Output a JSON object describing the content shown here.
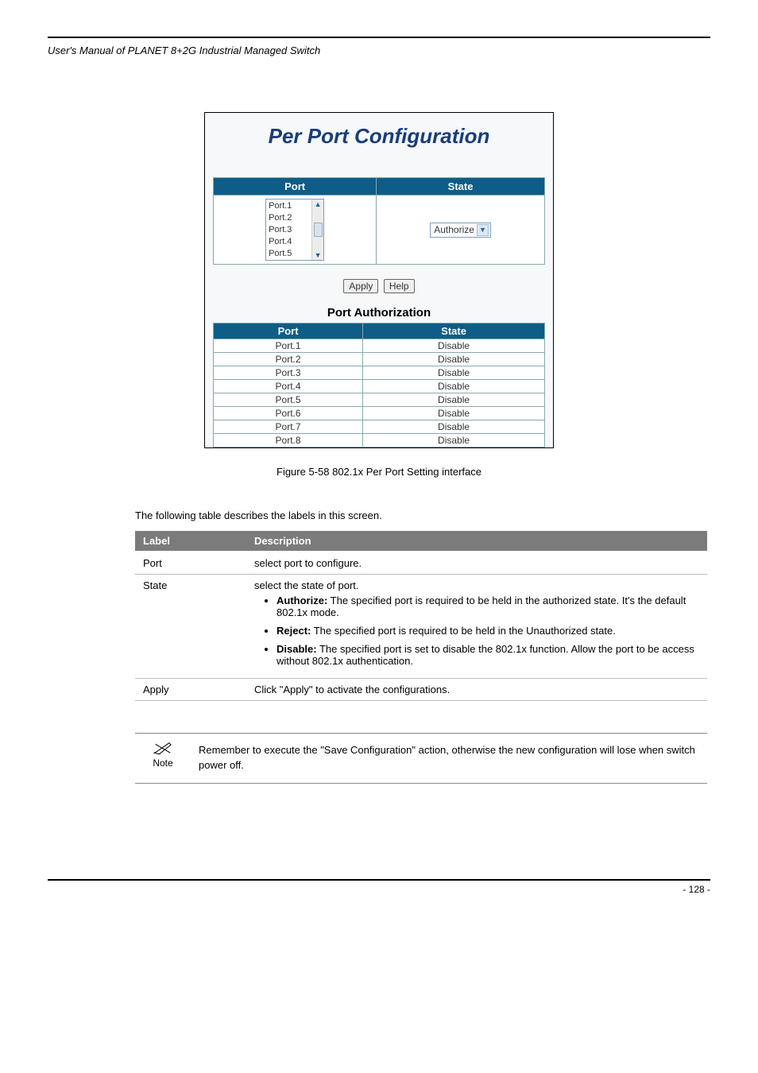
{
  "header": {
    "left": "User's Manual of PLANET 8+2G Industrial Managed Switch",
    "right": ""
  },
  "screenshot": {
    "title": "Per Port Configuration",
    "configHeaders": [
      "Port",
      "State"
    ],
    "portList": [
      "Port.1",
      "Port.2",
      "Port.3",
      "Port.4",
      "Port.5"
    ],
    "stateSelected": "Authorize",
    "buttons": {
      "apply": "Apply",
      "help": "Help"
    },
    "authTitle": "Port Authorization",
    "authHeaders": [
      "Port",
      "State"
    ],
    "authRows": [
      {
        "port": "Port.1",
        "state": "Disable"
      },
      {
        "port": "Port.2",
        "state": "Disable"
      },
      {
        "port": "Port.3",
        "state": "Disable"
      },
      {
        "port": "Port.4",
        "state": "Disable"
      },
      {
        "port": "Port.5",
        "state": "Disable"
      },
      {
        "port": "Port.6",
        "state": "Disable"
      },
      {
        "port": "Port.7",
        "state": "Disable"
      },
      {
        "port": "Port.8",
        "state": "Disable"
      }
    ]
  },
  "caption": "Figure 5-58 802.1x Per Port Setting interface",
  "introLine": "The following table describes the labels in this screen.",
  "descTable": {
    "headers": [
      "Label",
      "Description"
    ],
    "rows": [
      {
        "label": "Port",
        "desc_plain": "select port to configure.",
        "bullets": []
      },
      {
        "label": "State",
        "desc_plain": "select the state of port.",
        "bullets": [
          {
            "b": "Authorize:",
            "t": " The specified port is required to be held in the authorized state. It's the default 802.1x mode."
          },
          {
            "b": "Reject:",
            "t": " The specified port is required to be held in the Unauthorized state."
          },
          {
            "b": "Disable:",
            "t": " The specified port is set to disable the 802.1x function. Allow the port to be access without 802.1x authentication."
          }
        ]
      },
      {
        "label": "Apply",
        "desc_plain": "Click \"Apply\" to activate the configurations.",
        "bullets": []
      }
    ]
  },
  "note": {
    "label": "Note",
    "text": "Remember to execute the \"Save Configuration\" action, otherwise the new configuration will lose when switch power off."
  },
  "footer": {
    "left": "",
    "right": "- 128 -"
  }
}
